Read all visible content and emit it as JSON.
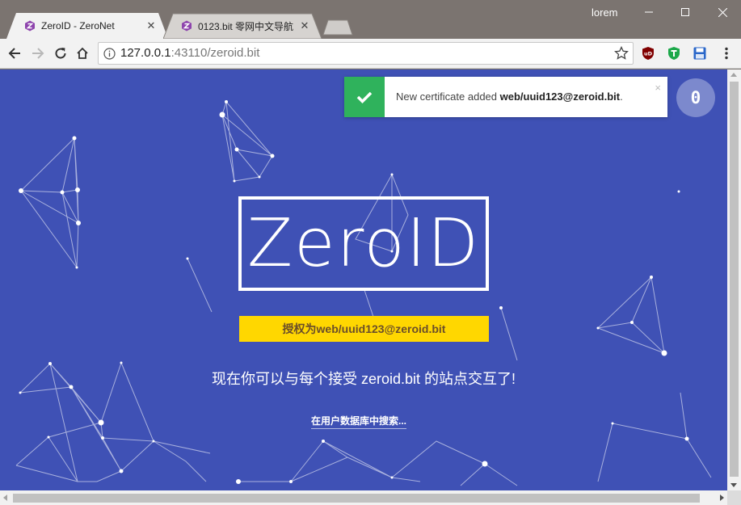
{
  "browser": {
    "tabs": [
      {
        "title": "ZeroID - ZeroNet",
        "active": true
      },
      {
        "title": "0123.bit 零网中文导航 -",
        "active": false
      }
    ],
    "window_user": "lorem",
    "url_host": "127.0.0.1",
    "url_rest": ":43110/zeroid.bit",
    "extensions": [
      "ublock-icon",
      "tampermonkey-icon",
      "save-icon"
    ]
  },
  "notification": {
    "text": "New certificate added ",
    "cert": "web/uuid123@zeroid.bit",
    "suffix": ".",
    "close": "×"
  },
  "badge": {
    "count": "0"
  },
  "page": {
    "logo": "ZeroID",
    "auth_label": "授权为web/uuid123@zeroid.bit",
    "message": "现在你可以与每个接受 zeroid.bit 的站点交互了!",
    "search_link": "在用户数据库中搜索..."
  },
  "colors": {
    "page_bg": "#3f51b5",
    "auth_bar": "#ffd700",
    "notif_success": "#2fb25c"
  }
}
